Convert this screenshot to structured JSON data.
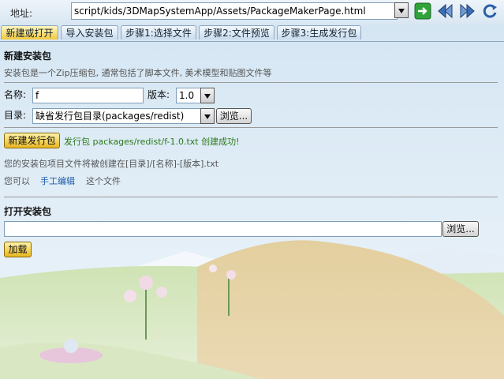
{
  "address_bar": {
    "label": "地址:",
    "url": "script/kids/3DMapSystemApp/Assets/PackageMakerPage.html"
  },
  "tabs": [
    {
      "label": "新建或打开",
      "active": true
    },
    {
      "label": "导入安装包",
      "active": false
    },
    {
      "label": "步骤1:选择文件",
      "active": false
    },
    {
      "label": "步骤2:文件预览",
      "active": false
    },
    {
      "label": "步骤3:生成发行包",
      "active": false
    }
  ],
  "new_package": {
    "title": "新建安装包",
    "description": "安装包是一个Zip压缩包, 通常包括了脚本文件, 美术模型和贴图文件等",
    "name_label": "名称:",
    "name_value": "f",
    "version_label": "版本:",
    "version_value": "1.0",
    "dir_label": "目录:",
    "dir_value": "缺省发行包目录(packages/redist)",
    "browse_label": "浏览...",
    "create_button": "新建发行包",
    "success_message": "发行包 packages/redist/f-1.0.txt 创建成功!",
    "path_hint": "您的安装包项目文件将被创建在[目录]/[名称]-[版本].txt",
    "edit_prefix": "您可以",
    "edit_link": "手工编辑",
    "edit_suffix": "这个文件"
  },
  "open_package": {
    "title": "打开安装包",
    "path_value": "",
    "browse_label": "浏览...",
    "load_button": "加载"
  },
  "colors": {
    "accent_yellow": "#f2c93a",
    "success_green": "#2b7a1a",
    "link_blue": "#1a5aa8"
  }
}
